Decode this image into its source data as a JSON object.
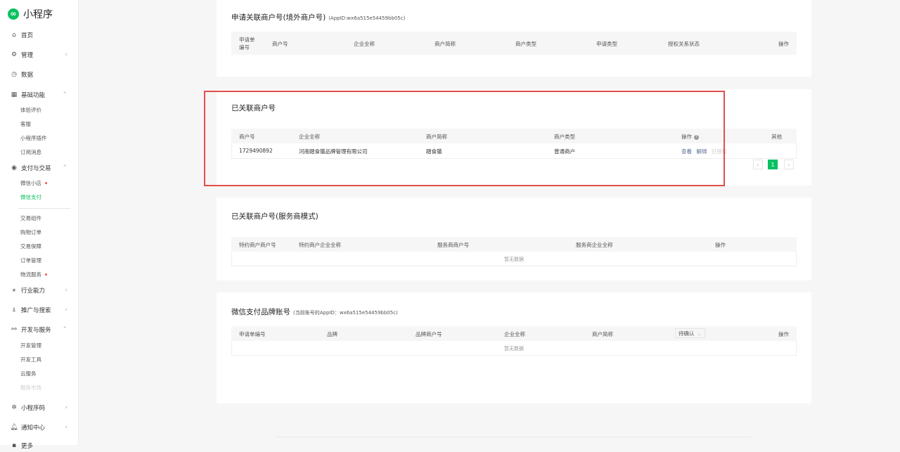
{
  "app": {
    "title": "小程序"
  },
  "nav": {
    "home": "首页",
    "manage": "管理",
    "data": "数据",
    "basic": "基础功能",
    "basic_items": [
      "体验评价",
      "客服",
      "小程序插件",
      "订阅消息"
    ],
    "pay": "支付与交易",
    "pay_items": [
      "微信小店",
      "微信支付"
    ],
    "trade_items": [
      "交易组件",
      "购物订单",
      "交易保障",
      "订单管理",
      "物流服务"
    ],
    "industry": "行业能力",
    "promo": "推广与搜索",
    "dev": "开发与服务",
    "dev_items": [
      "开发管理",
      "开发工具",
      "云服务",
      "服务市场"
    ],
    "code": "小程序码",
    "notify": "通知中心",
    "more": "更多"
  },
  "card1": {
    "title": "申请关联商户号(境外商户号)",
    "appid": "(AppID:wx6a515e54459bb05c)",
    "headers": [
      "申请单编号",
      "商户号",
      "企业全称",
      "商户简称",
      "商户类型",
      "申请类型",
      "授权关系状态",
      "操作"
    ]
  },
  "card2": {
    "title": "已关联商户号",
    "headers": [
      "商户号",
      "企业全称",
      "商户简称",
      "商户类型",
      "操作",
      "其他"
    ],
    "row": {
      "merchant_id": "1729490892",
      "company": "河南踏食猫品牌管理有限公司",
      "short_name": "踏食猫",
      "type": "普通商户",
      "action_view": "查看",
      "action_unbind": "解绑",
      "action_auth": "已授权"
    },
    "page": "1"
  },
  "card3": {
    "title": "已关联商户号(服务商模式)",
    "headers": [
      "特约商户商户号",
      "特约商户企业全称",
      "服务商商户号",
      "服务商企业全称",
      "操作"
    ],
    "empty": "暂无数据"
  },
  "card4": {
    "title": "微信支付品牌账号",
    "appid": "(当前账号的AppID：wx6a515e54459bb05c)",
    "headers": [
      "申请单编号",
      "品牌",
      "品牌商户号",
      "企业全称",
      "商户简称",
      "操作"
    ],
    "status_filter": "待确认",
    "empty": "暂无数据"
  }
}
